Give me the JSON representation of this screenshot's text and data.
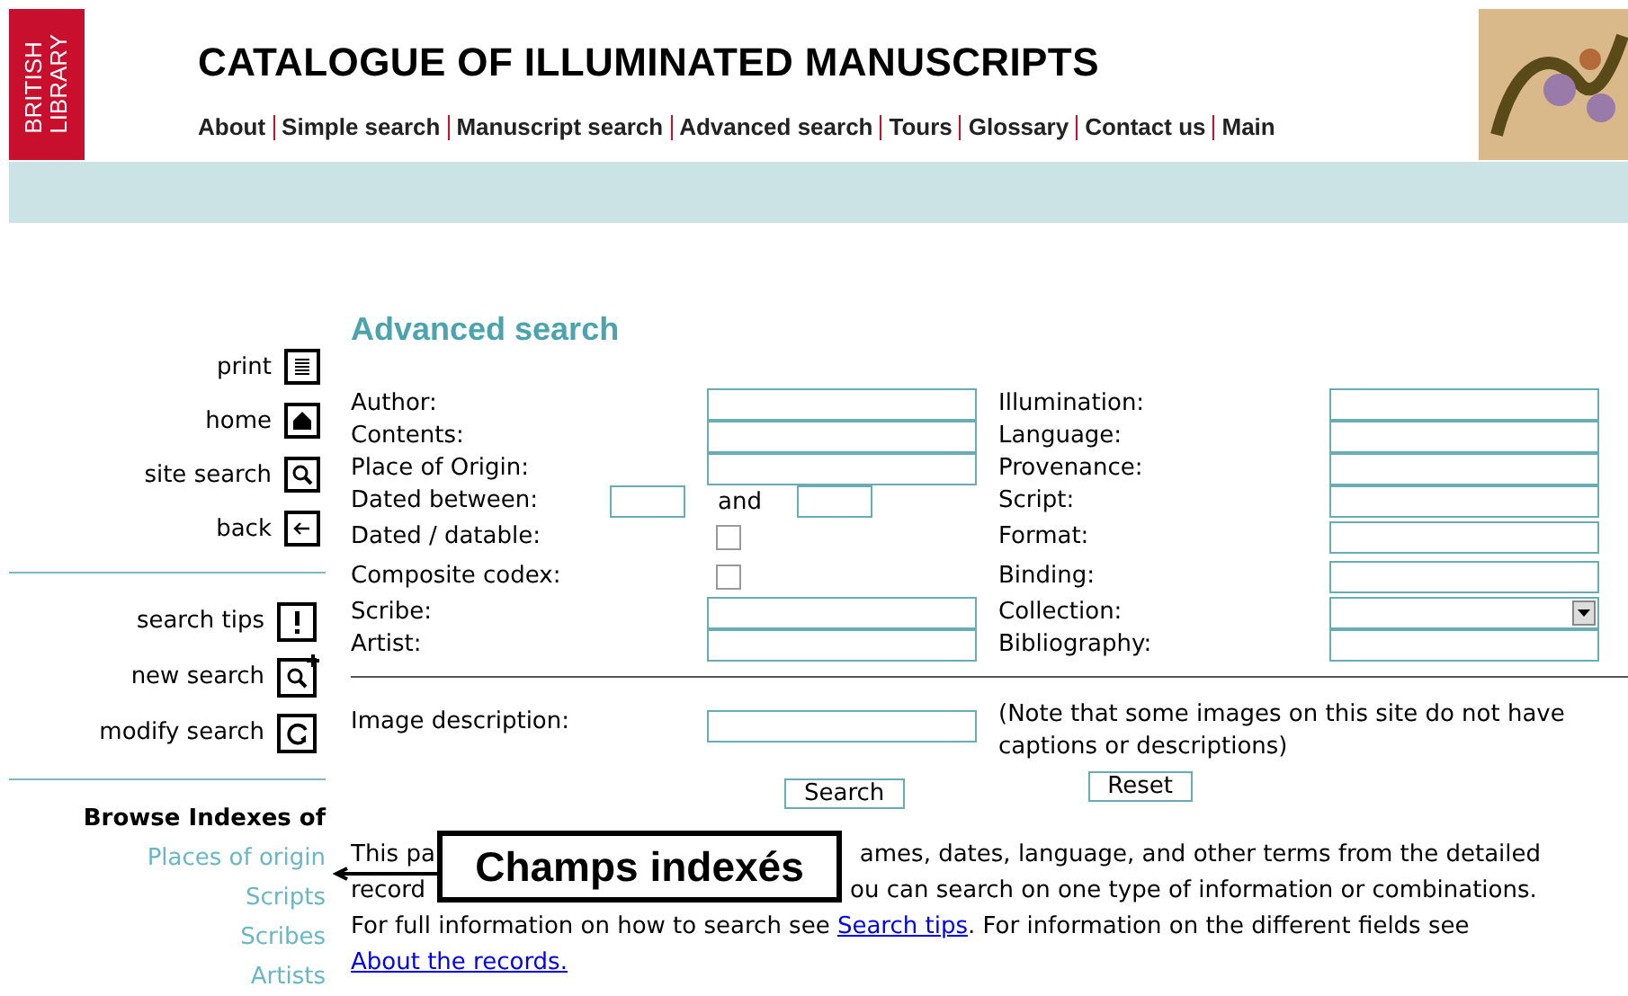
{
  "header": {
    "logo_lines": [
      "BRITISH",
      "LIBRARY"
    ],
    "title": "CATALOGUE OF ILLUMINATED MANUSCRIPTS",
    "nav": [
      "About",
      "Simple search",
      "Manuscript search",
      "Advanced search",
      "Tours",
      "Glossary",
      "Contact us",
      "Main"
    ]
  },
  "sidebar": {
    "tools": [
      {
        "label": "print",
        "kind": "print"
      },
      {
        "label": "home",
        "kind": "home"
      },
      {
        "label": "site search",
        "kind": "search"
      },
      {
        "label": "back",
        "kind": "back"
      }
    ],
    "search_tools": [
      {
        "label": "search tips",
        "kind": "tips"
      },
      {
        "label": "new search",
        "kind": "new"
      },
      {
        "label": "modify search",
        "kind": "modify"
      }
    ],
    "browse_heading": "Browse Indexes of",
    "browse_links": [
      "Places of origin",
      "Scripts",
      "Scribes",
      "Artists"
    ]
  },
  "form": {
    "title": "Advanced search",
    "rows": [
      {
        "left": {
          "label": "Author:",
          "kind": "text"
        },
        "right": {
          "label": "Illumination:",
          "kind": "text"
        }
      },
      {
        "left": {
          "label": "Contents:",
          "kind": "text"
        },
        "right": {
          "label": "Language:",
          "kind": "text"
        }
      },
      {
        "left": {
          "label": "Place of Origin:",
          "kind": "text"
        },
        "right": {
          "label": "Provenance:",
          "kind": "text"
        }
      },
      {
        "left": {
          "label": "Dated between:",
          "kind": "range",
          "joiner": "and"
        },
        "right": {
          "label": "Script:",
          "kind": "text"
        }
      },
      {
        "left": {
          "label": "Dated / datable:",
          "kind": "checkbox",
          "checked": false
        },
        "right": {
          "label": "Format:",
          "kind": "text"
        }
      },
      {
        "left": {
          "label": "Composite codex:",
          "kind": "checkbox",
          "checked": false
        },
        "right": {
          "label": "Binding:",
          "kind": "text"
        }
      },
      {
        "left": {
          "label": "Scribe:",
          "kind": "text"
        },
        "right": {
          "label": "Collection:",
          "kind": "select"
        }
      },
      {
        "left": {
          "label": "Artist:",
          "kind": "text"
        },
        "right": {
          "label": "Bibliography:",
          "kind": "text"
        }
      }
    ],
    "image_description": {
      "label": "Image description:",
      "note": "(Note that some images on this site do not have captions or descriptions)"
    },
    "buttons": [
      "Search",
      "Reset"
    ]
  },
  "intro": {
    "line_1_start": "This pa",
    "line_1_end": "ames, dates, language, and other terms from the detailed",
    "line_2_start": "record",
    "line_2_end": "ou can search on one type of information or combinations.",
    "line_3_before": "For full information on how to search see",
    "line_3_link": "Search tips",
    "line_3_after": ". For information on the different fields see",
    "line_4_link": "About the records."
  },
  "callout": "Champs indexés"
}
